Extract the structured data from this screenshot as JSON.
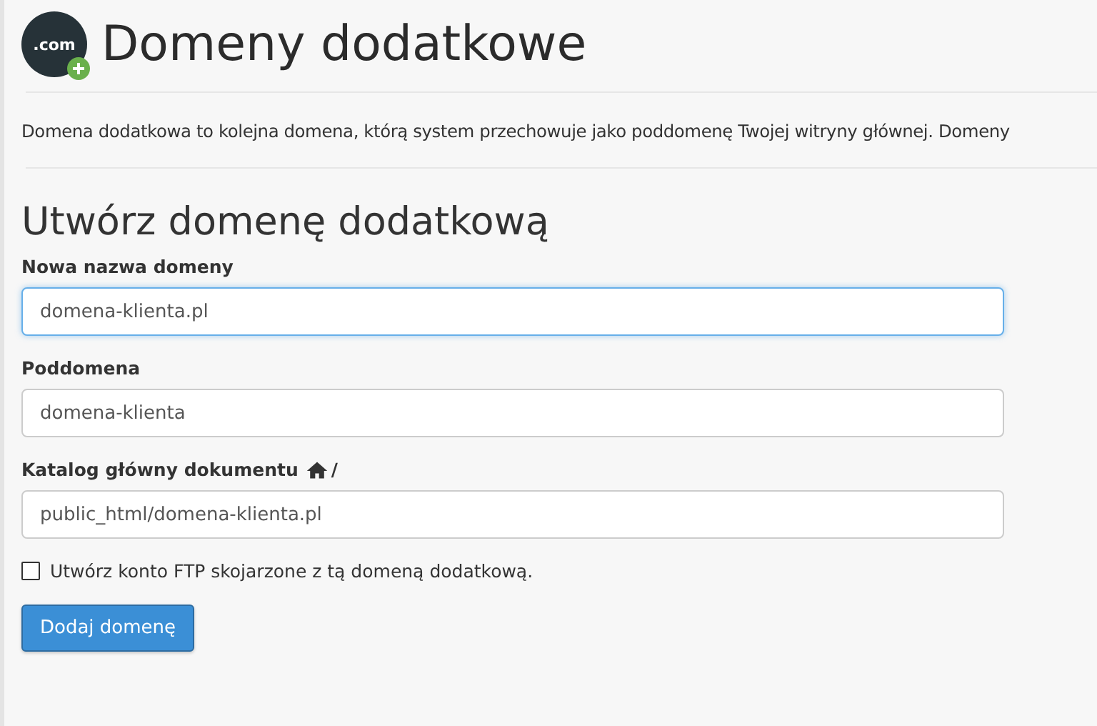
{
  "header": {
    "logo_text": ".com",
    "title": "Domeny dodatkowe"
  },
  "description": "Domena dodatkowa to kolejna domena, którą system przechowuje jako poddomenę Twojej witryny głównej. Domeny",
  "form": {
    "title": "Utwórz domenę dodatkową",
    "fields": [
      {
        "label": "Nowa nazwa domeny",
        "value": "domena-klienta.pl",
        "focused": true,
        "home_icon": false
      },
      {
        "label": "Poddomena",
        "value": "domena-klienta",
        "focused": false,
        "home_icon": false
      },
      {
        "label": "Katalog główny dokumentu",
        "suffix": "/",
        "value": "public_html/domena-klienta.pl",
        "focused": false,
        "home_icon": true
      }
    ],
    "checkbox": {
      "label": "Utwórz konto FTP skojarzone z tą domeną dodatkową.",
      "checked": false
    },
    "submit": "Dodaj domenę"
  }
}
